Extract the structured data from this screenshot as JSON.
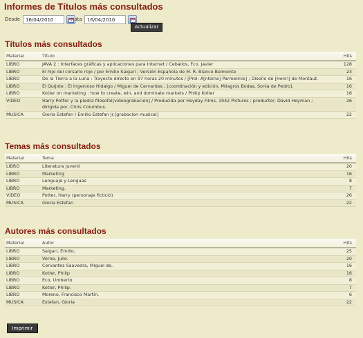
{
  "page": {
    "title": "Informes de Títulos más consultados"
  },
  "filters": {
    "from_label": "Desde",
    "from_value": "16/04/2010",
    "to_label": "sta",
    "to_value": "16/04/2010",
    "update_label": "Actualizar"
  },
  "titles_section": {
    "heading": "Títulos más consultados",
    "columns": [
      "Material",
      "Título",
      "Hits"
    ],
    "rows": [
      [
        "LIBRO",
        "JAVA 2 : Interfaces gráficas y aplicaciones para Internet / Ceballos, Fco. Javier",
        "128"
      ],
      [
        "LIBRO",
        "El hijo del corsario rojo / por Emilio Salgari ; Versión Española de M. R. Blanco Belmonte",
        "23"
      ],
      [
        "LIBRO",
        "De la Tierra a la Luna : Trayecto directo en 97 horas 20 minutos / [Prol: A[ntoine] Parmelinie] ; Diseño de [Henri] de Montaut.",
        "16"
      ],
      [
        "LIBRO",
        "El Quijote : El Ingenioso Hidalgo / Miguel de Cervantes ; [coordinación y edición, Milagros Bodas, Sonia de Pedro].",
        "16"
      ],
      [
        "LIBRO",
        "Kotler on marketing : how to create, win, and dominate markets / Philip Kotler",
        "16"
      ],
      [
        "VIDEO",
        "Harry Potter y la piedra filosofal[videograbación] / Producida por Heyday Films, 1942 Pictures ; productor, David Heyman ; dirigida por, Chris Columbus.",
        "26"
      ],
      [
        "MUSICA",
        "Gloria Estefan / Emilio Estefan Jr.[grabacion musical]",
        "22"
      ]
    ]
  },
  "themes_section": {
    "heading": "Temas más consultados",
    "columns": [
      "Material",
      "Tema",
      "Hits"
    ],
    "rows": [
      [
        "LIBRO",
        "Literatura Juvenil",
        "20"
      ],
      [
        "LIBRO",
        "Marketing",
        "16"
      ],
      [
        "LIBRO",
        "Lenguaje y Lenguas",
        "8"
      ],
      [
        "LIBRO",
        "Marketing.",
        "7"
      ],
      [
        "VIDEO",
        "Potter, Harry (personaje ficticio)",
        "26"
      ],
      [
        "MUSICA",
        "Gloria Estefan",
        "22"
      ]
    ]
  },
  "authors_section": {
    "heading": "Autores más consultados",
    "columns": [
      "Material",
      "Autor",
      "Hits"
    ],
    "rows": [
      [
        "LIBRO",
        "Salgari, Emilio,",
        "25"
      ],
      [
        "LIBRO",
        "Verne, Julio.",
        "20"
      ],
      [
        "LIBRO",
        "Cervantes Saavedra, Miguel de,",
        "16"
      ],
      [
        "LIBRO",
        "Kotler, Philip",
        "16"
      ],
      [
        "LIBRO",
        "Eco, Umberto",
        "8"
      ],
      [
        "LIBRO",
        "Kotler, Philip.",
        "7"
      ],
      [
        "LIBRO",
        "Moreno, Francisco Martín.",
        "6"
      ],
      [
        "MUSICA",
        "Estefan, Gloria",
        "22"
      ]
    ]
  },
  "footer": {
    "print_label": "Imprimir"
  },
  "icons": {
    "calendar": "calendar-icon"
  }
}
